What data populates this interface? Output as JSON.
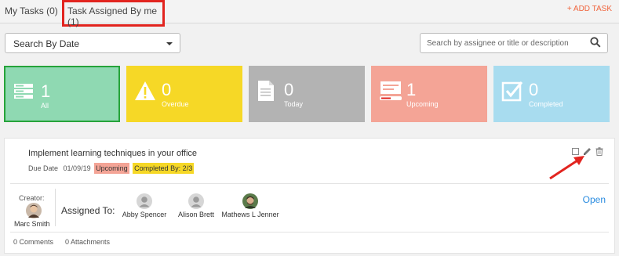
{
  "tabs": {
    "my_tasks": "My Tasks (0)",
    "assigned_by_me": "Task Assigned By me (1)",
    "add_task": "+ ADD TASK"
  },
  "filters": {
    "date_select": "Search By Date",
    "search_placeholder": "Search by assignee or title or description"
  },
  "summary_cards": [
    {
      "count": "1",
      "label": "All",
      "icon": "list-icon",
      "color": "#8fd9b2"
    },
    {
      "count": "0",
      "label": "Overdue",
      "icon": "warning-icon",
      "color": "#f6d826"
    },
    {
      "count": "0",
      "label": "Today",
      "icon": "document-icon",
      "color": "#b3b3b3"
    },
    {
      "count": "1",
      "label": "Upcoming",
      "icon": "upcoming-icon",
      "color": "#f4a496"
    },
    {
      "count": "0",
      "label": "Completed",
      "icon": "checkbox-icon",
      "color": "#a8dcef"
    }
  ],
  "task": {
    "title": "Implement learning techniques in your office",
    "due_label": "Due Date",
    "due_date": "01/09/19",
    "status_badge": "Upcoming",
    "completed_by": "Completed By: 2/3",
    "creator_label": "Creator:",
    "creator_name": "Marc Smith",
    "assigned_label": "Assigned To:",
    "assignees": [
      "Abby Spencer",
      "Alison Brett",
      "Mathews L Jenner"
    ],
    "open_label": "Open",
    "comments": "0 Comments",
    "attachments": "0 Attachments"
  },
  "colors": {
    "accent": "#f0643c",
    "link": "#2a8ce0",
    "highlight_border": "#e2241f"
  }
}
